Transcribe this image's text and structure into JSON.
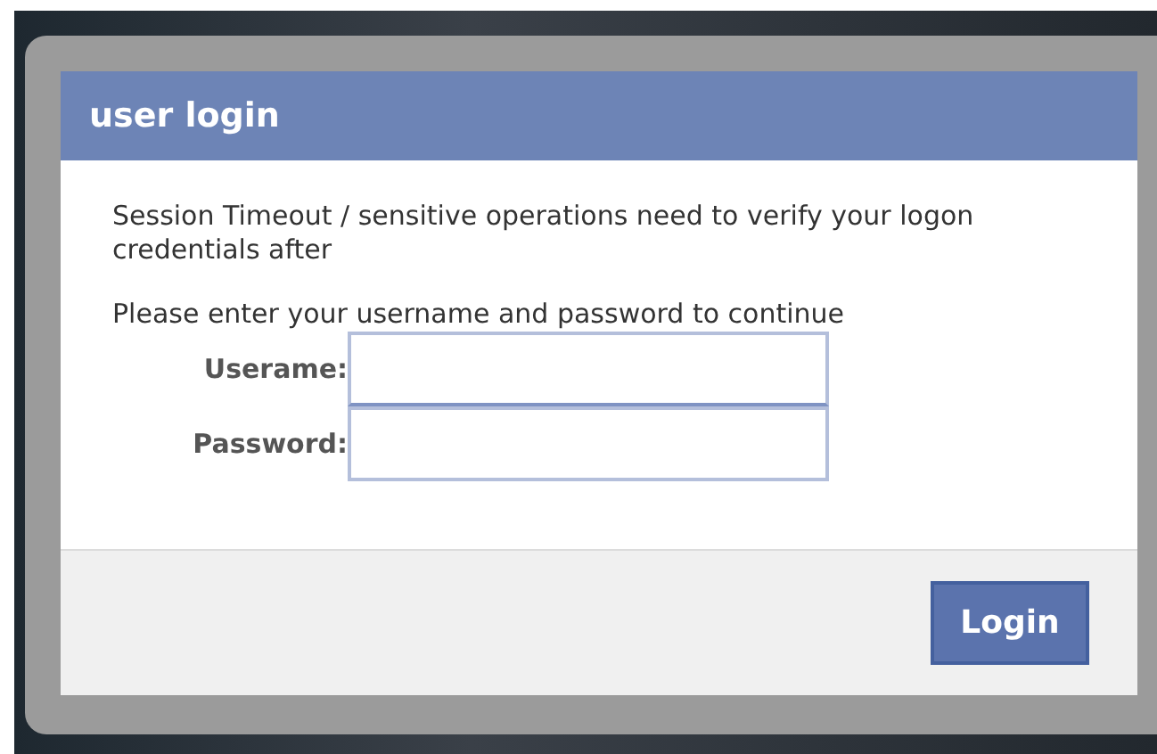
{
  "dialog": {
    "title": "user login",
    "message": "Session Timeout / sensitive operations need to verify your logon credentials after",
    "instruction": "Please enter your username and password to continue",
    "fields": [
      {
        "label": "Userame:"
      },
      {
        "label": "Password:"
      }
    ],
    "buttons": [
      "Login"
    ]
  }
}
